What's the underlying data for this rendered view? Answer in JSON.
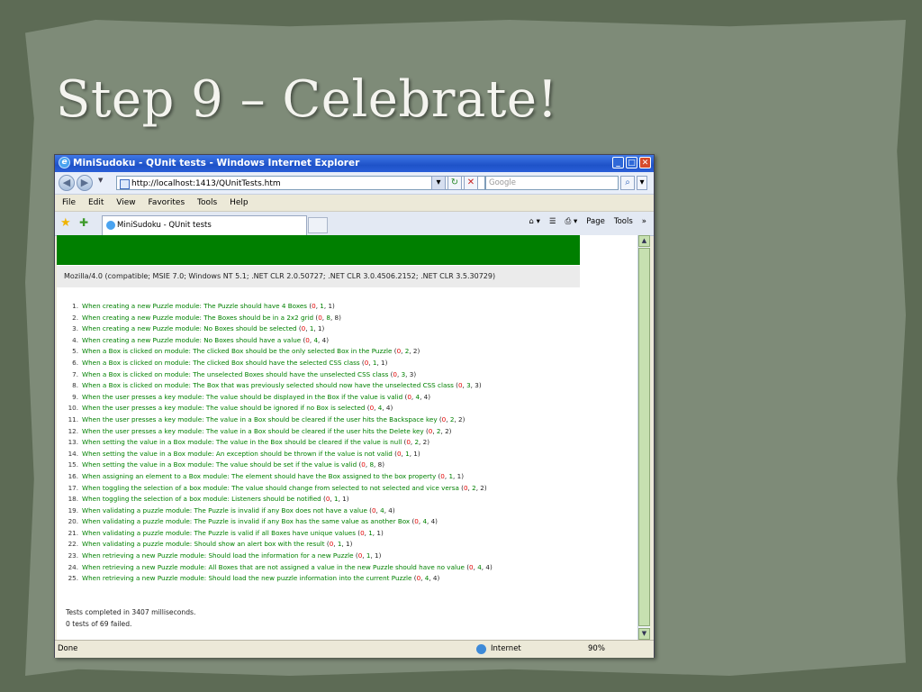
{
  "slide": {
    "title": "Step 9 – Celebrate!"
  },
  "window": {
    "title": "MiniSudoku - QUnit tests - Windows Internet Explorer",
    "address": "http://localhost:1413/QUnitTests.htm",
    "search_placeholder": "Google",
    "menu": [
      "File",
      "Edit",
      "View",
      "Favorites",
      "Tools",
      "Help"
    ],
    "tab_label": "MiniSudoku - QUnit tests",
    "tools": [
      "Page",
      "Tools"
    ],
    "status_done": "Done",
    "status_zone": "Internet",
    "status_zoom": "90%"
  },
  "page": {
    "user_agent": "Mozilla/4.0 (compatible; MSIE 7.0; Windows NT 5.1; .NET CLR 2.0.50727; .NET CLR 3.0.4506.2152; .NET CLR 3.5.30729)",
    "tests": [
      {
        "n": "1.",
        "text": "When creating a new Puzzle module: The Puzzle should have 4 Boxes",
        "fail": "0",
        "pass": "1",
        "total": "1"
      },
      {
        "n": "2.",
        "text": "When creating a new Puzzle module: The Boxes should be in a 2x2 grid",
        "fail": "0",
        "pass": "8",
        "total": "8"
      },
      {
        "n": "3.",
        "text": "When creating a new Puzzle module: No Boxes should be selected",
        "fail": "0",
        "pass": "1",
        "total": "1"
      },
      {
        "n": "4.",
        "text": "When creating a new Puzzle module: No Boxes should have a value",
        "fail": "0",
        "pass": "4",
        "total": "4"
      },
      {
        "n": "5.",
        "text": "When a Box is clicked on module: The clicked Box should be the only selected Box in the Puzzle",
        "fail": "0",
        "pass": "2",
        "total": "2"
      },
      {
        "n": "6.",
        "text": "When a Box is clicked on module: The clicked Box should have the selected CSS class",
        "fail": "0",
        "pass": "1",
        "total": "1"
      },
      {
        "n": "7.",
        "text": "When a Box is clicked on module: The unselected Boxes should have the unselected CSS class",
        "fail": "0",
        "pass": "3",
        "total": "3"
      },
      {
        "n": "8.",
        "text": "When a Box is clicked on module: The Box that was previously selected should now have the unselected CSS class",
        "fail": "0",
        "pass": "3",
        "total": "3"
      },
      {
        "n": "9.",
        "text": "When the user presses a key module: The value should be displayed in the Box if the value is valid",
        "fail": "0",
        "pass": "4",
        "total": "4"
      },
      {
        "n": "10.",
        "text": "When the user presses a key module: The value should be ignored if no Box is selected",
        "fail": "0",
        "pass": "4",
        "total": "4"
      },
      {
        "n": "11.",
        "text": "When the user presses a key module: The value in a Box should be cleared if the user hits the Backspace key",
        "fail": "0",
        "pass": "2",
        "total": "2"
      },
      {
        "n": "12.",
        "text": "When the user presses a key module: The value in a Box should be cleared if the user hits the Delete key",
        "fail": "0",
        "pass": "2",
        "total": "2"
      },
      {
        "n": "13.",
        "text": "When setting the value in a Box module: The value in the Box should be cleared if the value is null",
        "fail": "0",
        "pass": "2",
        "total": "2"
      },
      {
        "n": "14.",
        "text": "When setting the value in a Box module: An exception should be thrown if the value is not valid",
        "fail": "0",
        "pass": "1",
        "total": "1"
      },
      {
        "n": "15.",
        "text": "When setting the value in a Box module: The value should be set if the value is valid",
        "fail": "0",
        "pass": "8",
        "total": "8"
      },
      {
        "n": "16.",
        "text": "When assigning an element to a Box module: The element should have the Box assigned to the box property",
        "fail": "0",
        "pass": "1",
        "total": "1"
      },
      {
        "n": "17.",
        "text": "When toggling the selection of a box module: The value should change from selected to not selected and vice versa",
        "fail": "0",
        "pass": "2",
        "total": "2"
      },
      {
        "n": "18.",
        "text": "When toggling the selection of a box module: Listeners should be notified",
        "fail": "0",
        "pass": "1",
        "total": "1"
      },
      {
        "n": "19.",
        "text": "When validating a puzzle module: The Puzzle is invalid if any Box does not have a value",
        "fail": "0",
        "pass": "4",
        "total": "4"
      },
      {
        "n": "20.",
        "text": "When validating a puzzle module: The Puzzle is invalid if any Box has the same value as another Box",
        "fail": "0",
        "pass": "4",
        "total": "4"
      },
      {
        "n": "21.",
        "text": "When validating a puzzle module: The Puzzle is valid if all Boxes have unique values",
        "fail": "0",
        "pass": "1",
        "total": "1"
      },
      {
        "n": "22.",
        "text": "When validating a puzzle module: Should show an alert box with the result",
        "fail": "0",
        "pass": "1",
        "total": "1"
      },
      {
        "n": "23.",
        "text": "When retrieving a new Puzzle module: Should load the information for a new Puzzle",
        "fail": "0",
        "pass": "1",
        "total": "1"
      },
      {
        "n": "24.",
        "text": "When retrieving a new Puzzle module: All Boxes that are not assigned a value in the new Puzzle should have no value",
        "fail": "0",
        "pass": "4",
        "total": "4"
      },
      {
        "n": "25.",
        "text": "When retrieving a new Puzzle module: Should load the new puzzle information into the current Puzzle",
        "fail": "0",
        "pass": "4",
        "total": "4"
      }
    ],
    "summary_line1": "Tests completed in 3407 milliseconds.",
    "summary_line2": "0 tests of 69 failed."
  }
}
